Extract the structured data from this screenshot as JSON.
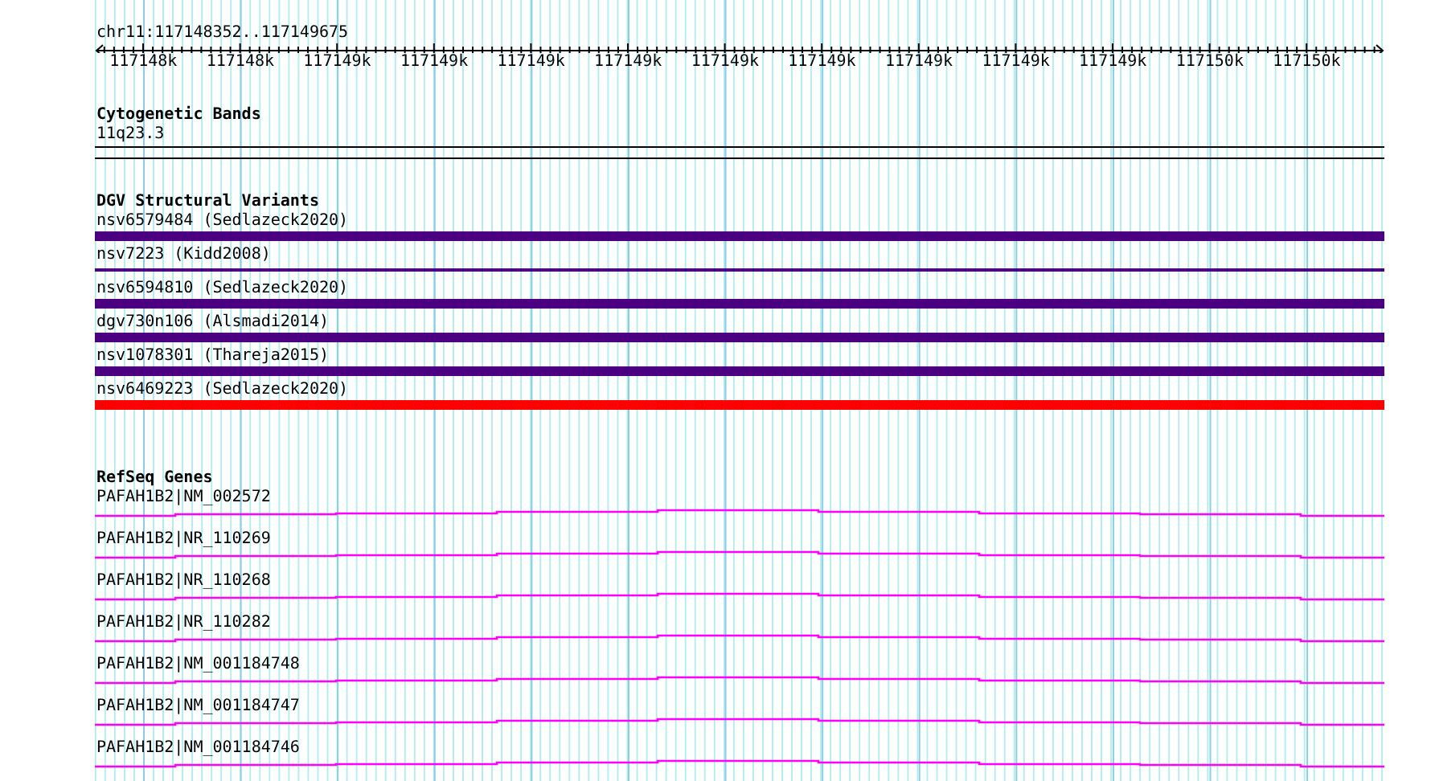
{
  "ruler": {
    "region": "chr11:117148352..117149675",
    "ticks": [
      "117148k",
      "117148k",
      "117149k",
      "117149k",
      "117149k",
      "117149k",
      "117149k",
      "117149k",
      "117149k",
      "117149k",
      "117149k",
      "117150k",
      "117150k"
    ]
  },
  "tracks": [
    {
      "title": "Cytogenetic Bands",
      "kind": "bands",
      "items": [
        {
          "label": "11q23.3"
        }
      ]
    },
    {
      "title": "DGV Structural Variants",
      "kind": "variants",
      "items": [
        {
          "label": "nsv6579484 (Sedlazeck2020)",
          "kind": "bar",
          "color": "#4b0082"
        },
        {
          "label": "nsv7223 (Kidd2008)",
          "kind": "line",
          "color": "#4b0082"
        },
        {
          "label": "nsv6594810 (Sedlazeck2020)",
          "kind": "bar",
          "color": "#4b0082"
        },
        {
          "label": "dgv730n106 (Alsmadi2014)",
          "kind": "bar",
          "color": "#4b0082"
        },
        {
          "label": "nsv1078301 (Thareja2015)",
          "kind": "bar",
          "color": "#4b0082"
        },
        {
          "label": "nsv6469223 (Sedlazeck2020)",
          "kind": "bar",
          "color": "#ff0000"
        }
      ]
    },
    {
      "title": "RefSeq Genes",
      "kind": "genes",
      "items": [
        {
          "label": "PAFAH1B2|NM_002572"
        },
        {
          "label": "PAFAH1B2|NR_110269"
        },
        {
          "label": "PAFAH1B2|NR_110268"
        },
        {
          "label": "PAFAH1B2|NR_110282"
        },
        {
          "label": "PAFAH1B2|NM_001184748"
        },
        {
          "label": "PAFAH1B2|NM_001184747"
        },
        {
          "label": "PAFAH1B2|NM_001184746"
        }
      ]
    }
  ]
}
